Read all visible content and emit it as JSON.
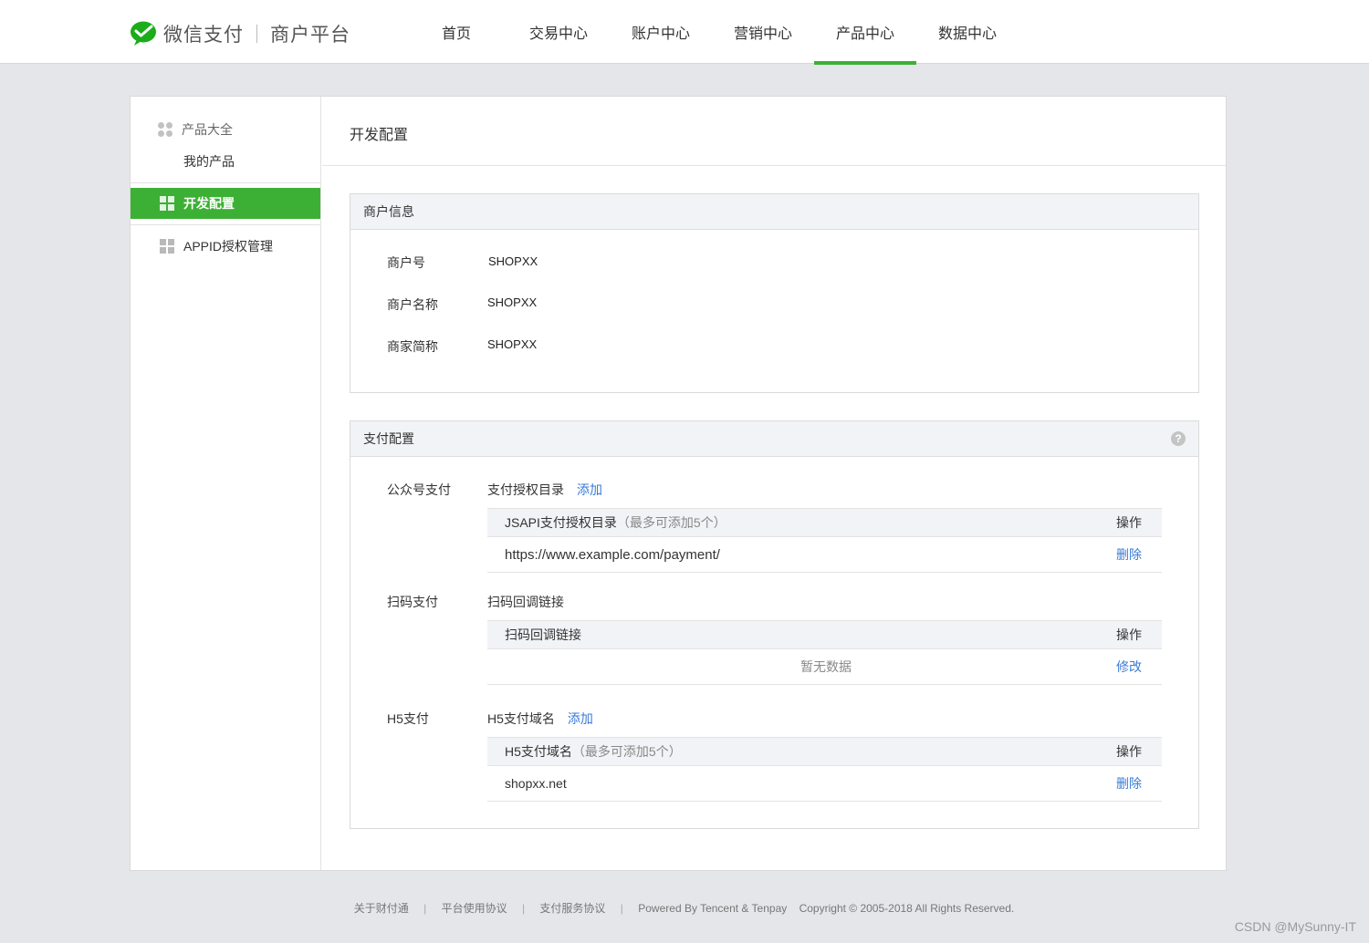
{
  "header": {
    "brand_name": "微信支付",
    "platform_name": "商户平台",
    "nav": [
      {
        "label": "首页"
      },
      {
        "label": "交易中心"
      },
      {
        "label": "账户中心"
      },
      {
        "label": "营销中心"
      },
      {
        "label": "产品中心"
      },
      {
        "label": "数据中心"
      }
    ],
    "active_nav": "产品中心",
    "accent_color": "#3cb034"
  },
  "sidebar": {
    "group_title": "产品大全",
    "group_sub": "我的产品",
    "items": [
      {
        "label": "开发配置",
        "active": true
      },
      {
        "label": "APPID授权管理",
        "active": false
      }
    ]
  },
  "main": {
    "page_title": "开发配置",
    "merchant_info": {
      "title": "商户信息",
      "rows": [
        {
          "label": "商户号",
          "value": "SHOPXX"
        },
        {
          "label": "商户名称",
          "value": "SHOPXX"
        },
        {
          "label": "商家简称",
          "value": "SHOPXX"
        }
      ]
    },
    "pay_config": {
      "title": "支付配置",
      "help_icon": "?",
      "sections": [
        {
          "label": "公众号支付",
          "title": "支付授权目录",
          "action": "添加",
          "table_head": "JSAPI支付授权目录",
          "table_head_note": "（最多可添加5个）",
          "op_header": "操作",
          "row_value": "https://www.example.com/payment/",
          "row_action": "删除"
        },
        {
          "label": "扫码支付",
          "title": "扫码回调链接",
          "table_head": "扫码回调链接",
          "op_header": "操作",
          "row_value": "暂无数据",
          "row_action": "修改"
        },
        {
          "label": "H5支付",
          "title": "H5支付域名",
          "action": "添加",
          "table_head": "H5支付域名",
          "table_head_note": "（最多可添加5个）",
          "op_header": "操作",
          "row_value": "shopxx.net",
          "row_action": "删除"
        }
      ]
    }
  },
  "footer": {
    "links": [
      "关于财付通",
      "平台使用协议",
      "支付服务协议"
    ],
    "powered": "Powered By Tencent & Tenpay",
    "copyright": "Copyright © 2005-2018 All Rights Reserved.",
    "separator": "|"
  },
  "watermark": "CSDN @MySunny-IT"
}
